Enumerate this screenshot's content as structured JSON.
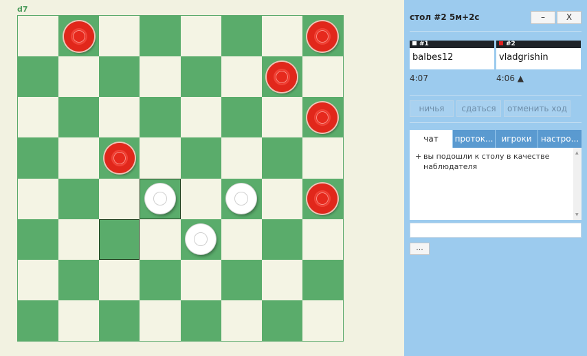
{
  "board": {
    "last_move": "d7",
    "colors": {
      "light": "#f4f4e4",
      "dark": "#5aac6b",
      "red_piece": "#e6291d",
      "white_piece": "#ffffff"
    },
    "highlighted_squares": [
      {
        "row": 4,
        "col": 3
      },
      {
        "row": 5,
        "col": 2
      }
    ],
    "pieces": [
      {
        "color": "red",
        "row": 0,
        "col": 1
      },
      {
        "color": "red",
        "row": 0,
        "col": 7
      },
      {
        "color": "red",
        "row": 1,
        "col": 6
      },
      {
        "color": "red",
        "row": 2,
        "col": 7
      },
      {
        "color": "red",
        "row": 3,
        "col": 2
      },
      {
        "color": "white",
        "row": 4,
        "col": 3
      },
      {
        "color": "white",
        "row": 4,
        "col": 5
      },
      {
        "color": "red",
        "row": 4,
        "col": 7
      },
      {
        "color": "white",
        "row": 5,
        "col": 4
      }
    ]
  },
  "panel": {
    "table_title": "стол #2   5м+2с",
    "minimize_label": "–",
    "close_label": "X",
    "players": [
      {
        "label": "#1",
        "name": "balbes12",
        "clock": "4:07",
        "swatch": "#ffffff"
      },
      {
        "label": "#2",
        "name": "vladgrishin",
        "clock": "4:06 ▲",
        "swatch": "#e02020"
      }
    ],
    "actions": {
      "draw": "ничья",
      "resign": "сдаться",
      "takeback": "отменить ход"
    },
    "tabs": {
      "chat": "чат",
      "log": "проток...",
      "players": "игроки",
      "settings": "настро..."
    },
    "chat": {
      "plus": "+",
      "message": "вы подошли к столу в качестве наблюдателя",
      "input_value": ""
    },
    "more_label": "..."
  }
}
